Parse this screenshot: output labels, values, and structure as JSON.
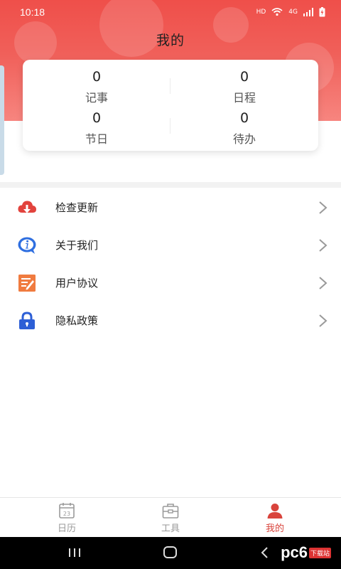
{
  "status_bar": {
    "time": "10:18",
    "indicators": [
      "HD",
      "wifi-icon",
      "4G",
      "signal-icon",
      "battery-charging-icon"
    ]
  },
  "page": {
    "title": "我的"
  },
  "stats": [
    {
      "value": "0",
      "label": "记事"
    },
    {
      "value": "0",
      "label": "日程"
    },
    {
      "value": "0",
      "label": "节日"
    },
    {
      "value": "0",
      "label": "待办"
    }
  ],
  "menu": [
    {
      "label": "检查更新",
      "icon": "cloud-download-icon"
    },
    {
      "label": "关于我们",
      "icon": "info-bubble-icon"
    },
    {
      "label": "用户协议",
      "icon": "document-edit-icon"
    },
    {
      "label": "隐私政策",
      "icon": "lock-icon"
    }
  ],
  "bottom_nav": [
    {
      "label": "日历",
      "icon": "calendar-icon",
      "active": false
    },
    {
      "label": "工具",
      "icon": "toolbox-icon",
      "active": false
    },
    {
      "label": "我的",
      "icon": "person-icon",
      "active": true
    }
  ],
  "calendar_icon_day": "23",
  "watermark": {
    "text": "pc6",
    "sub": "下载站"
  },
  "colors": {
    "header": "#ef4f4a",
    "accent": "#d9443c",
    "info_blue": "#2f6fe0",
    "doc_orange": "#f07b3f",
    "lock_blue": "#2d5fd6",
    "cloud_red": "#e2433d"
  }
}
